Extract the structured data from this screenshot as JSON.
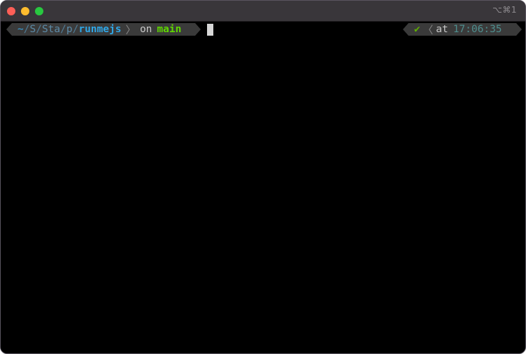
{
  "window": {
    "title_shortcut": "⌥⌘1"
  },
  "prompt": {
    "path": {
      "home": "~",
      "sep1": "/",
      "p1": "S",
      "sep2": "/",
      "p2": "Sta",
      "sep3": "/",
      "p3": "p",
      "sep4": "/",
      "current_dir": "runmejs"
    },
    "separator": "〉",
    "on_label": "on",
    "branch": "main",
    "status_check": "✔",
    "right_separator": "〈",
    "at_label": "at",
    "time": "17:06:35"
  },
  "colors": {
    "background": "#000000",
    "segment_bg": "#3a3a3a",
    "dir_color": "#2fa6e6",
    "branch_color": "#5fd700",
    "time_color": "#4e8e8e"
  }
}
